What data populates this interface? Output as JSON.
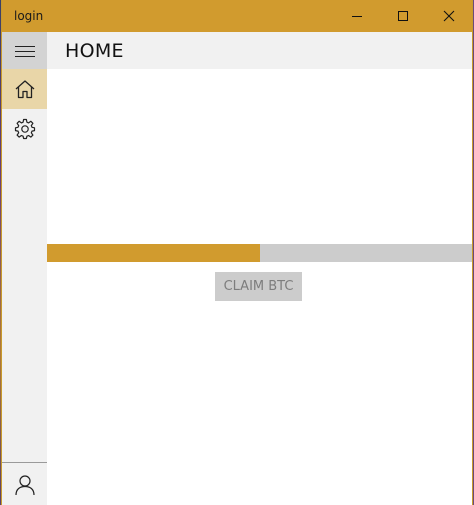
{
  "window": {
    "title": "login",
    "accent_color": "#d19b2e",
    "controls": [
      "minimize-icon",
      "maximize-icon",
      "close-icon"
    ]
  },
  "sidebar": {
    "items": [
      {
        "icon": "hamburger-menu-icon",
        "selected": false
      },
      {
        "icon": "home-icon",
        "selected": true
      },
      {
        "icon": "gear-icon",
        "selected": false
      },
      {
        "icon": "user-icon",
        "selected": false
      }
    ]
  },
  "header": {
    "title": "HOME"
  },
  "main": {
    "progress_fraction": 0.5,
    "claim_label": "CLAIM BTC",
    "claim_enabled": false
  }
}
